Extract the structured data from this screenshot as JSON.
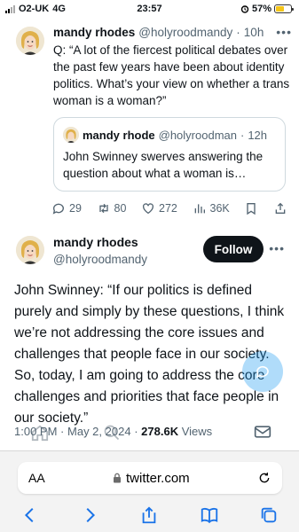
{
  "status_bar": {
    "carrier": "O2-UK",
    "network": "4G",
    "time": "23:57",
    "battery_percent": "57%",
    "battery_level": 0.57
  },
  "tweet1": {
    "name": "mandy rhodes",
    "handle": "@holyroodmandy",
    "separator": "·",
    "time_ago": "10h",
    "text": "Q: “A lot of the fiercest political debates over the past few years have been about identity politics. What’s your view on whether a trans woman is a woman?”",
    "quote": {
      "name": "mandy rhode",
      "handle": "@holyroodman",
      "separator": "·",
      "time_ago": "12h",
      "text": "John Swinney swerves answering the question about what a woman is…"
    },
    "actions": {
      "replies": "29",
      "retweets": "80",
      "likes": "272",
      "views": "36K"
    }
  },
  "tweet2": {
    "name": "mandy rhodes",
    "handle": "@holyroodmandy",
    "follow_label": "Follow",
    "text": "John Swinney: “If our politics is defined purely and simply by these questions, I think we’re not addressing the core issues and challenges that people face in our society. So, today, I am going to address the core challenges and priorities that face people in our society.”",
    "meta_time": "1:00 PM",
    "meta_sep": "·",
    "meta_date": "May 2, 2024",
    "meta_views_count": "278.6K",
    "meta_views_label": "Views"
  },
  "safari": {
    "aa_label": "AA",
    "url": "twitter.com"
  },
  "colors": {
    "accent": "#1d9bf0",
    "text": "#0f1419",
    "muted": "#536471",
    "safari_blue": "#1a73e8"
  }
}
